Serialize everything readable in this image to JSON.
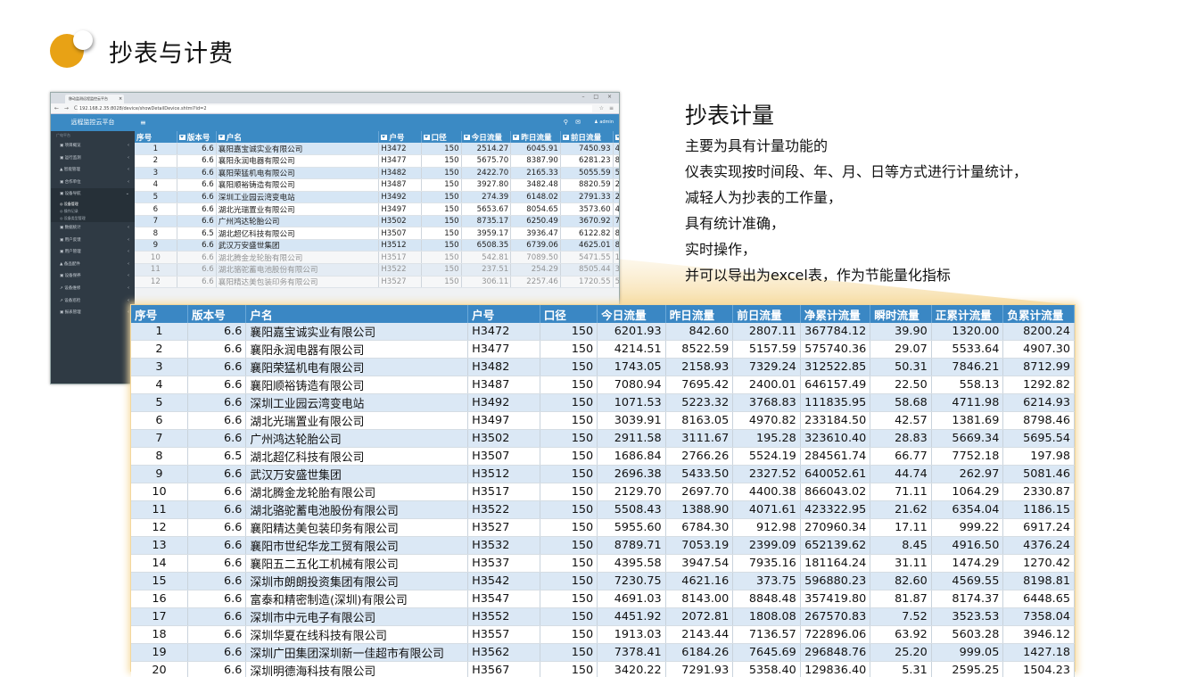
{
  "slide": {
    "title": "抄表与计费",
    "desc_title": "抄表计量",
    "desc_lines": [
      "主要为具有计量功能的",
      "仪表实现按时间段、年、月、日等方式进行计量统计，",
      "减轻人为抄表的工作量，",
      "具有统计准确，",
      "实时操作，",
      "并可以导出为excel表，作为节能量化指标"
    ],
    "accent_color": "#e8a215",
    "highlight_color": "#f7e3b4"
  },
  "browser": {
    "tab_title": "移动监测远程监控云平台",
    "tab_close": "×",
    "window_buttons": "– □ ×",
    "nav_buttons": "← → C",
    "url": "192.168.2.35:8028/device/showDetailDevice.shtml?id=2",
    "url_icons": "☆ ≡",
    "sidebar": {
      "title": "远程监控云平台",
      "subtitle": "广电平台",
      "items": [
        {
          "label": "▣ 项目概览"
        },
        {
          "label": "▣ 运行监测"
        },
        {
          "label": "▲ 智能管理"
        },
        {
          "label": "▣ 合作单位"
        },
        {
          "label": "▣ 设备导航",
          "open": true
        },
        {
          "label": "◎ 设备管理",
          "child": true,
          "active": true
        },
        {
          "label": "◎ 操作记录",
          "child": true
        },
        {
          "label": "◎ 设备类型管理",
          "child": true
        },
        {
          "label": "▣ 数据统计"
        },
        {
          "label": "▣ 用户反馈"
        },
        {
          "label": "▣ 用户管理"
        },
        {
          "label": "▲ 备品配件"
        },
        {
          "label": "▣ 设备保养"
        },
        {
          "label": "↗ 设备维修"
        },
        {
          "label": "↗ 设备巡检"
        },
        {
          "label": "▣ 报表管理"
        }
      ]
    },
    "header": {
      "menu": "≡",
      "icons": "⚲ ✉",
      "user": "♟ admin"
    },
    "table": {
      "columns": [
        "序号",
        "版本号",
        "户名",
        "户号",
        "口径",
        "今日流量",
        "昨日流量",
        "前日流量",
        "净"
      ],
      "rows": [
        [
          "1",
          "6.6",
          "襄阳嘉宝诚实业有限公司",
          "H3472",
          "150",
          "2514.27",
          "6045.91",
          "7450.93",
          "4"
        ],
        [
          "2",
          "6.6",
          "襄阳永润电器有限公司",
          "H3477",
          "150",
          "5675.70",
          "8387.90",
          "6281.23",
          "8"
        ],
        [
          "3",
          "6.6",
          "襄阳荣猛机电有限公司",
          "H3482",
          "150",
          "2422.70",
          "2165.33",
          "5055.59",
          "5"
        ],
        [
          "4",
          "6.6",
          "襄阳顺裕铸造有限公司",
          "H3487",
          "150",
          "3927.80",
          "3482.48",
          "8820.59",
          "2"
        ],
        [
          "5",
          "6.6",
          "深圳工业园云湾变电站",
          "H3492",
          "150",
          "274.39",
          "6148.02",
          "2791.33",
          "2"
        ],
        [
          "6",
          "6.6",
          "湖北光瑞置业有限公司",
          "H3497",
          "150",
          "5653.67",
          "8054.65",
          "3573.60",
          "4"
        ],
        [
          "7",
          "6.6",
          "广州鸿达轮胎公司",
          "H3502",
          "150",
          "8735.17",
          "6250.49",
          "3670.92",
          "7"
        ],
        [
          "8",
          "6.5",
          "湖北超亿科技有限公司",
          "H3507",
          "150",
          "3959.17",
          "3936.47",
          "6122.82",
          "8"
        ],
        [
          "9",
          "6.6",
          "武汉万安盛世集团",
          "H3512",
          "150",
          "6508.35",
          "6739.06",
          "4625.01",
          "8"
        ],
        [
          "10",
          "6.6",
          "湖北腾金龙轮胎有限公司",
          "H3517",
          "150",
          "542.81",
          "7089.50",
          "5471.55",
          "1"
        ],
        [
          "11",
          "6.6",
          "湖北骆驼蓄电池股份有限公司",
          "H3522",
          "150",
          "237.51",
          "254.29",
          "8505.44",
          "3"
        ],
        [
          "12",
          "6.6",
          "襄阳精达美包装印务有限公司",
          "H3527",
          "150",
          "306.11",
          "2257.46",
          "1720.55",
          "5"
        ]
      ]
    }
  },
  "zoom_table": {
    "columns": [
      "序号",
      "版本号",
      "户名",
      "户号",
      "口径",
      "今日流量",
      "昨日流量",
      "前日流量",
      "净累计流量",
      "瞬时流量",
      "正累计流量",
      "负累计流量"
    ],
    "rows": [
      [
        "1",
        "6.6",
        "襄阳嘉宝诚实业有限公司",
        "H3472",
        "150",
        "6201.93",
        "842.60",
        "2807.11",
        "367784.12",
        "39.90",
        "1320.00",
        "8200.24"
      ],
      [
        "2",
        "6.6",
        "襄阳永润电器有限公司",
        "H3477",
        "150",
        "4214.51",
        "8522.59",
        "5157.59",
        "575740.36",
        "29.07",
        "5533.64",
        "4907.30"
      ],
      [
        "3",
        "6.6",
        "襄阳荣猛机电有限公司",
        "H3482",
        "150",
        "1743.05",
        "2158.93",
        "7329.24",
        "312522.85",
        "50.31",
        "7846.21",
        "8712.99"
      ],
      [
        "4",
        "6.6",
        "襄阳顺裕铸造有限公司",
        "H3487",
        "150",
        "7080.94",
        "7695.42",
        "2400.01",
        "646157.49",
        "22.50",
        "558.13",
        "1292.82"
      ],
      [
        "5",
        "6.6",
        "深圳工业园云湾变电站",
        "H3492",
        "150",
        "1071.53",
        "5223.32",
        "3768.83",
        "111835.95",
        "58.68",
        "4711.98",
        "6214.93"
      ],
      [
        "6",
        "6.6",
        "湖北光瑞置业有限公司",
        "H3497",
        "150",
        "3039.91",
        "8163.05",
        "4970.82",
        "233184.50",
        "42.57",
        "1381.69",
        "8798.46"
      ],
      [
        "7",
        "6.6",
        "广州鸿达轮胎公司",
        "H3502",
        "150",
        "2911.58",
        "3111.67",
        "195.28",
        "323610.40",
        "28.83",
        "5669.34",
        "5695.54"
      ],
      [
        "8",
        "6.5",
        "湖北超亿科技有限公司",
        "H3507",
        "150",
        "1686.84",
        "2766.26",
        "5524.19",
        "284561.74",
        "66.77",
        "7752.18",
        "197.98"
      ],
      [
        "9",
        "6.6",
        "武汉万安盛世集团",
        "H3512",
        "150",
        "2696.38",
        "5433.50",
        "2327.52",
        "640052.61",
        "44.74",
        "262.97",
        "5081.46"
      ],
      [
        "10",
        "6.6",
        "湖北腾金龙轮胎有限公司",
        "H3517",
        "150",
        "2129.70",
        "2697.70",
        "4400.38",
        "866043.02",
        "71.11",
        "1064.29",
        "2330.87"
      ],
      [
        "11",
        "6.6",
        "湖北骆驼蓄电池股份有限公司",
        "H3522",
        "150",
        "5508.43",
        "1388.90",
        "4071.61",
        "423322.95",
        "21.62",
        "6354.04",
        "1186.15"
      ],
      [
        "12",
        "6.6",
        "襄阳精达美包装印务有限公司",
        "H3527",
        "150",
        "5955.60",
        "6784.30",
        "912.98",
        "270960.34",
        "17.11",
        "999.22",
        "6917.24"
      ],
      [
        "13",
        "6.6",
        "襄阳市世纪华龙工贸有限公司",
        "H3532",
        "150",
        "8789.71",
        "7053.19",
        "2399.09",
        "652139.62",
        "8.45",
        "4916.50",
        "4376.24"
      ],
      [
        "14",
        "6.6",
        "襄阳五二五化工机械有限公司",
        "H3537",
        "150",
        "4395.58",
        "3947.54",
        "7935.16",
        "181164.24",
        "31.11",
        "1474.29",
        "1270.42"
      ],
      [
        "15",
        "6.6",
        "深圳市朗朗投资集团有限公司",
        "H3542",
        "150",
        "7230.75",
        "4621.16",
        "373.75",
        "596880.23",
        "82.60",
        "4569.55",
        "8198.81"
      ],
      [
        "16",
        "6.6",
        "富泰和精密制造(深圳)有限公司",
        "H3547",
        "150",
        "4691.03",
        "8143.00",
        "8848.48",
        "357419.80",
        "81.87",
        "8174.37",
        "6448.65"
      ],
      [
        "17",
        "6.6",
        "深圳市中元电子有限公司",
        "H3552",
        "150",
        "4451.92",
        "2072.81",
        "1808.08",
        "267570.83",
        "7.52",
        "3523.53",
        "7358.04"
      ],
      [
        "18",
        "6.6",
        "深圳华夏在线科技有限公司",
        "H3557",
        "150",
        "1913.03",
        "2143.44",
        "7136.57",
        "722896.06",
        "63.92",
        "5603.28",
        "3946.12"
      ],
      [
        "19",
        "6.6",
        "深圳广田集团深圳新一佳超市有限公司",
        "H3562",
        "150",
        "7378.41",
        "6184.26",
        "7645.69",
        "296848.76",
        "25.20",
        "999.05",
        "1427.18"
      ],
      [
        "20",
        "6.6",
        "深圳明德海科技有限公司",
        "H3567",
        "150",
        "3420.22",
        "7291.93",
        "5358.40",
        "129836.40",
        "5.31",
        "2595.25",
        "1504.23"
      ]
    ]
  }
}
